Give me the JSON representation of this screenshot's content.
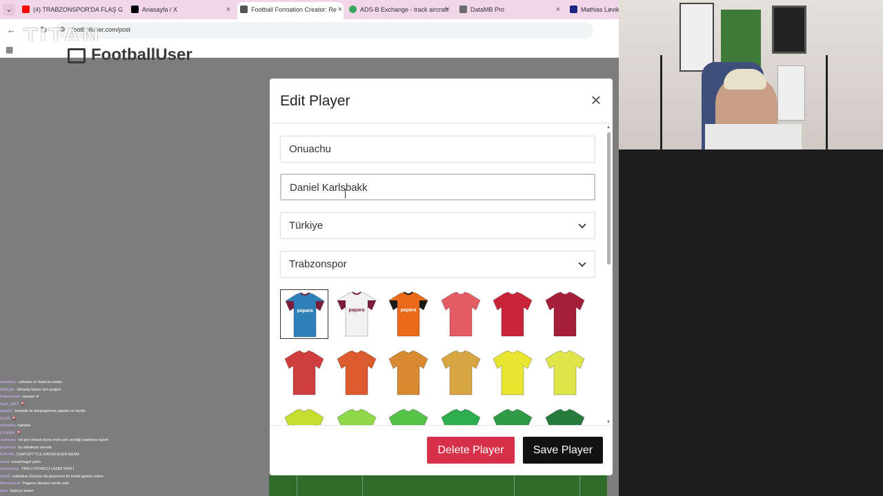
{
  "browser": {
    "tabs": [
      {
        "label": "(4) TRABZONSPOR'DA FLAŞ G",
        "favicon_color": "#ff0000"
      },
      {
        "label": "Anasayfa / X",
        "favicon_color": "#000000"
      },
      {
        "label": "Football Formation Creator: Re",
        "favicon_color": "#555555",
        "active": true
      },
      {
        "label": "ADS-B Exchange - track aircraft",
        "favicon_color": "#3aa55d"
      },
      {
        "label": "DataMB Pro",
        "favicon_color": "#6b6b6b"
      },
      {
        "label": "Mathias Løvik -",
        "favicon_color": "#1a237e"
      }
    ],
    "url": "footballuser.com/post",
    "overlay_watermark": "TITAN",
    "site_logo_text": "FootballUser"
  },
  "modal": {
    "title": "Edit Player",
    "fields": {
      "short_name": "Onuachu",
      "full_name": "Daniel Karlsbakk",
      "country": "Türkiye",
      "club": "Trabzonspor"
    },
    "delete_label": "Delete Player",
    "save_label": "Save Player"
  },
  "jerseys": [
    {
      "name": "trabzonspor-home",
      "color": "#2f7fb8",
      "accent": "#7a1d3a",
      "text": "papara",
      "selected": true
    },
    {
      "name": "trabzonspor-away",
      "color": "#f2f2f2",
      "accent": "#7a1d3a",
      "text": "papara"
    },
    {
      "name": "trabzonspor-third",
      "color": "#ea6a1a",
      "accent": "#1a1a1a",
      "text": "papara"
    },
    {
      "name": "coral",
      "color": "#e35b63"
    },
    {
      "name": "red",
      "color": "#c9253a"
    },
    {
      "name": "maroon",
      "color": "#a51e3a"
    },
    {
      "name": "brick",
      "color": "#cf3f3f"
    },
    {
      "name": "orange-red",
      "color": "#dd5a2e"
    },
    {
      "name": "orange",
      "color": "#d88932"
    },
    {
      "name": "gold",
      "color": "#d9a443"
    },
    {
      "name": "yellow",
      "color": "#e8e631"
    },
    {
      "name": "lime-yellow",
      "color": "#dee64a"
    },
    {
      "name": "chartreuse",
      "color": "#c6df2e"
    },
    {
      "name": "light-green",
      "color": "#8fd84a"
    },
    {
      "name": "green",
      "color": "#54c247"
    },
    {
      "name": "emerald",
      "color": "#2eae4e"
    },
    {
      "name": "forest",
      "color": "#2f9b45"
    },
    {
      "name": "dark-green",
      "color": "#257a3c"
    }
  ],
  "chat": [
    {
      "user": "sahaboyu",
      "msg": "sahanın en fazla bu kadar"
    },
    {
      "user": "ElifAydin",
      "msg": "efmanty bizem bel ayağım"
    },
    {
      "user": "bugunasistii",
      "msg": "opaaan ol"
    },
    {
      "user": "kaya_1967",
      "msg": "🎴"
    },
    {
      "user": "baba02",
      "msg": "mustafa ile karşılaştırma yaptılar mı lavdık"
    },
    {
      "user": "OLFA",
      "msg": "🎴"
    },
    {
      "user": "dumanka",
      "msg": "hahaha"
    },
    {
      "user": "FYNN04",
      "msg": "🎴"
    },
    {
      "user": "canbeyaz",
      "msg": "bir şey olmadı bana ertek pek sevdiği yapılması lazım"
    },
    {
      "user": "ibrahimkz",
      "msg": "bu tebelkem nerede"
    },
    {
      "user": "BJKTAN",
      "msg": "CHATGPT'YLE KAVGA EDEN ADAM"
    },
    {
      "user": "meral",
      "msg": "onuachugel yarın"
    },
    {
      "user": "selimkanan",
      "msg": "YERLİ OYUNCU LAZIM YERLİ"
    },
    {
      "user": "cimb9",
      "msg": "mabotkar iDeyiniz da geçerince iki hedef gösteri erlem"
    },
    {
      "user": "ilmentedeali",
      "msg": "Paganın devamı nerde amk"
    },
    {
      "user": "Mavi",
      "msg": "Sato'yu alalım"
    }
  ]
}
